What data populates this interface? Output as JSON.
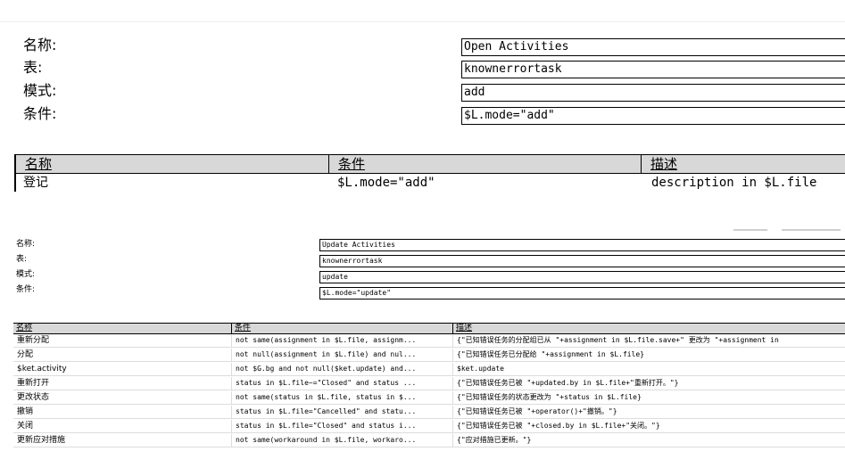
{
  "section1": {
    "labels": [
      "名称:",
      "表:",
      "模式:",
      "条件:"
    ],
    "fields": [
      "Open Activities",
      "knownerrortask",
      "add",
      "$L.mode=\"add\""
    ],
    "table": {
      "headers": [
        "名称",
        "条件",
        "描述"
      ],
      "rows": [
        [
          "登记",
          "$L.mode=\"add\"",
          "description in $L.file"
        ]
      ]
    }
  },
  "section2": {
    "labels": [
      "名称:",
      "表:",
      "模式:",
      "条件:"
    ],
    "fields": [
      "Update Activities",
      "knownerrortask",
      "update",
      "$L.mode=\"update\""
    ],
    "table": {
      "headers": [
        "名称",
        "条件",
        "描述"
      ],
      "rows": [
        [
          "重新分配",
          "not same(assignment in $L.file, assignm...",
          "{\"已知错误任务的分配组已从 \"+assignment in $L.file.save+\" 更改为 \"+assignment in"
        ],
        [
          "分配",
          "not null(assignment in $L.file) and nul...",
          "{\"已知错误任务已分配给 \"+assignment in $L.file}"
        ],
        [
          "$ket.activity",
          "not $G.bg and not null($ket.update) and...",
          "$ket.update"
        ],
        [
          "重新打开",
          "status in $L.file~=\"Closed\" and status ...",
          "{\"已知错误任务已被 \"+updated.by in $L.file+\"重新打开。\"}"
        ],
        [
          "更改状态",
          "not same(status in $L.file, status in $...",
          "{\"已知错误任务的状态更改为 \"+status in $L.file}"
        ],
        [
          "撤销",
          "status in $L.file=\"Cancelled\" and statu...",
          "{\"已知错误任务已被 \"+operator()+\"撤销。\"}"
        ],
        [
          "关闭",
          "status in $L.file=\"Closed\" and status i...",
          "{\"已知错误任务已被 \"+closed.by in $L.file+\"关闭。\"}"
        ],
        [
          "更新应对措施",
          "not same(workaround in $L.file, workaro...",
          "{\"应对措施已更新。\"}"
        ]
      ]
    }
  }
}
